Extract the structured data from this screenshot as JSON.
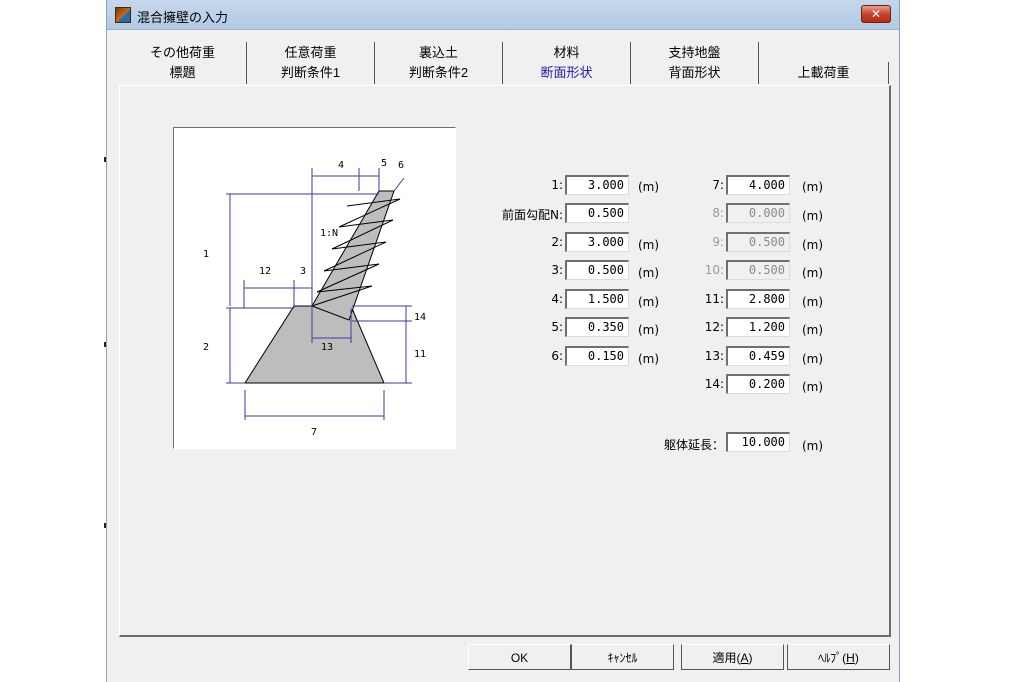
{
  "window": {
    "title": "混合擁壁の入力",
    "close_label": "✕"
  },
  "tabs_upper": [
    {
      "label": "その他荷重"
    },
    {
      "label": "任意荷重"
    },
    {
      "label": "裏込土"
    },
    {
      "label": "材料"
    },
    {
      "label": "支持地盤"
    }
  ],
  "tabs_lower": [
    {
      "label": "標題"
    },
    {
      "label": "判断条件1"
    },
    {
      "label": "判断条件2"
    },
    {
      "label": "断面形状",
      "active": true
    },
    {
      "label": "背面形状"
    },
    {
      "label": "上載荷重"
    }
  ],
  "diagram": {
    "labels": {
      "d1": "1",
      "d2": "2",
      "d3": "3",
      "d4": "4",
      "d5": "5",
      "d6": "6",
      "d7": "7",
      "d11": "11",
      "d12": "12",
      "d13": "13",
      "d14": "14",
      "slope": "1:N"
    }
  },
  "fields_left": [
    {
      "label": "1:",
      "value": "3.000",
      "unit": "(m)"
    },
    {
      "label": "前面勾配N:",
      "value": "0.500",
      "unit": ""
    },
    {
      "label": "2:",
      "value": "3.000",
      "unit": "(m)"
    },
    {
      "label": "3:",
      "value": "0.500",
      "unit": "(m)"
    },
    {
      "label": "4:",
      "value": "1.500",
      "unit": "(m)"
    },
    {
      "label": "5:",
      "value": "0.350",
      "unit": "(m)"
    },
    {
      "label": "6:",
      "value": "0.150",
      "unit": "(m)"
    }
  ],
  "fields_right": [
    {
      "label": "7:",
      "value": "4.000",
      "unit": "(m)",
      "disabled": false
    },
    {
      "label": "8:",
      "value": "0.000",
      "unit": "(m)",
      "disabled": true
    },
    {
      "label": "9:",
      "value": "0.500",
      "unit": "(m)",
      "disabled": true
    },
    {
      "label": "10:",
      "value": "0.500",
      "unit": "(m)",
      "disabled": true
    },
    {
      "label": "11:",
      "value": "2.800",
      "unit": "(m)",
      "disabled": false
    },
    {
      "label": "12:",
      "value": "1.200",
      "unit": "(m)",
      "disabled": false
    },
    {
      "label": "13:",
      "value": "0.459",
      "unit": "(m)",
      "disabled": false
    },
    {
      "label": "14:",
      "value": "0.200",
      "unit": "(m)",
      "disabled": false
    }
  ],
  "body_length": {
    "label": "躯体延長：",
    "value": "10.000",
    "unit": "(m)"
  },
  "buttons": {
    "ok": "OK",
    "cancel": "ｷｬﾝｾﾙ",
    "apply_prefix": "適用(",
    "apply_key": "A",
    "apply_suffix": ")",
    "help_prefix": "ﾍﾙﾌﾟ(",
    "help_key": "H",
    "help_suffix": ")"
  }
}
